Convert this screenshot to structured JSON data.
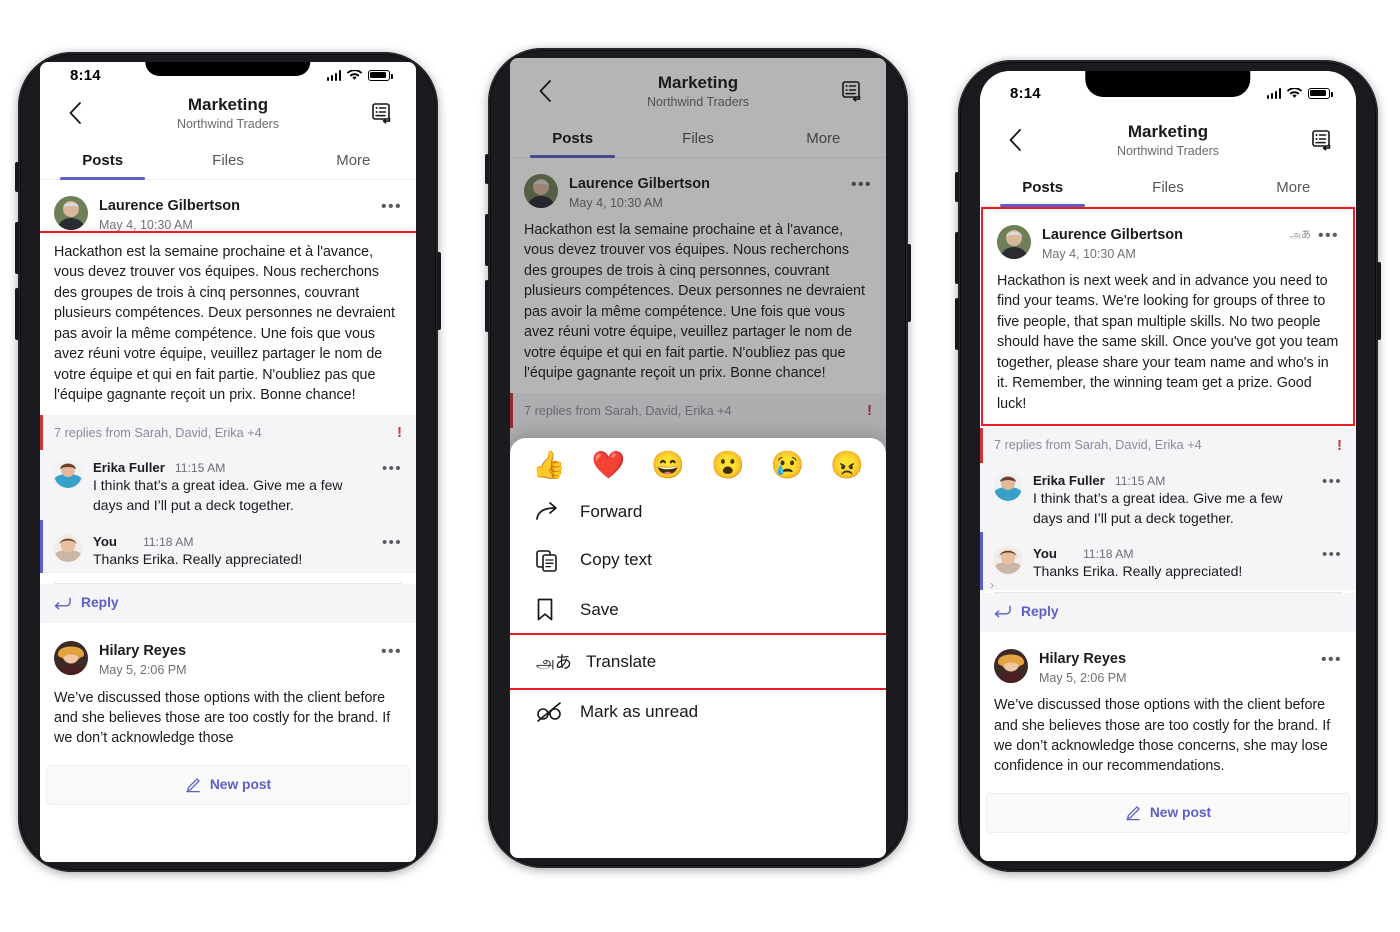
{
  "meta": {
    "app": "Microsoft Teams mobile",
    "accent": "#5b5fc7",
    "highlight_color": "#ee1b24",
    "alert_color": "#d13438",
    "reply_bar_bg": "#f5f5f7"
  },
  "status_bar": {
    "time": "8:14",
    "icons": [
      "cellular-signal-icon",
      "wifi-icon",
      "battery-icon"
    ]
  },
  "header": {
    "back_icon": "chevron-left-icon",
    "title": "Marketing",
    "subtitle": "Northwind Traders",
    "action_icon": "channel-notifications-icon"
  },
  "tabs": [
    {
      "label": "Posts",
      "active": true
    },
    {
      "label": "Files",
      "active": false
    },
    {
      "label": "More",
      "active": false
    }
  ],
  "posts": {
    "laurence": {
      "name": "Laurence Gilbertson",
      "time": "May 4, 10:30 AM",
      "body_fr": "Hackathon est la semaine prochaine et à l'avance, vous devez trouver vos équipes. Nous recherchons des groupes de trois à cinq personnes, couvrant plusieurs compétences. Deux personnes ne devraient pas avoir la même compétence. Une fois que vous avez réuni votre équipe, veuillez partager le nom de votre équipe et qui en fait partie. N'oubliez pas que l'équipe gagnante reçoit un prix. Bonne chance!",
      "body_en": "Hackathon is next week and in advance you need to find your teams. We're looking for groups of three to five people, that span multiple skills. No two people should have the same skill. Once you've got you team together, please share your team name and who's in it. Remember, the winning team get a prize. Good luck!",
      "more_icon": "more-options-icon",
      "translated_badge": "அあ"
    },
    "replies_summary": {
      "text": "7 replies from Sarah, David, Erika +4",
      "urgent_icon": "!"
    },
    "replies": [
      {
        "name": "Erika Fuller",
        "time": "11:15 AM",
        "text": "I think that’s a great idea. Give me a few days and I’ll put a deck together.",
        "more_icon": "more-options-icon"
      },
      {
        "name": "You",
        "time": "11:18 AM",
        "text": "Thanks Erika. Really appreciated!",
        "more_icon": "more-options-icon"
      }
    ],
    "reply_action": {
      "icon": "reply-arrow-icon",
      "label": "Reply"
    },
    "hilary": {
      "name": "Hilary Reyes",
      "time": "May 5, 2:06 PM",
      "body_short": "We’ve discussed those options with the client before and she believes those are too costly for the brand. If we don’t acknowledge those",
      "body_full": "We’ve discussed those options with the client before and she believes those are too costly for the brand. If we don’t acknowledge those concerns, she may lose confidence in our recommendations.",
      "more_icon": "more-options-icon"
    }
  },
  "new_post": {
    "icon": "compose-icon",
    "label": "New post"
  },
  "context_menu": {
    "reactions": [
      {
        "name": "thumbs-up-reaction",
        "glyph": "👍"
      },
      {
        "name": "heart-reaction",
        "glyph": "❤️"
      },
      {
        "name": "laugh-reaction",
        "glyph": "😄"
      },
      {
        "name": "surprised-reaction",
        "glyph": "😮"
      },
      {
        "name": "sad-reaction",
        "glyph": "😢"
      },
      {
        "name": "angry-reaction",
        "glyph": "😠"
      }
    ],
    "items": [
      {
        "label": "Forward",
        "icon": "forward-arrow-icon",
        "highlighted": false
      },
      {
        "label": "Copy text",
        "icon": "copy-icon",
        "highlighted": false
      },
      {
        "label": "Save",
        "icon": "bookmark-icon",
        "highlighted": false
      },
      {
        "label": "Translate",
        "icon": "translate-icon",
        "glyph": "அあ",
        "highlighted": true
      },
      {
        "label": "Mark as unread",
        "icon": "mark-unread-icon",
        "highlighted": false
      }
    ]
  }
}
